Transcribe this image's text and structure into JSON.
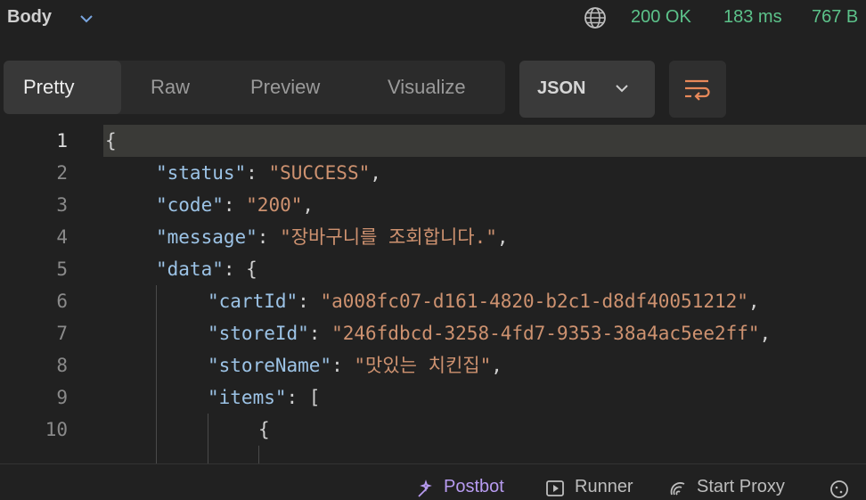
{
  "response": {
    "body_label": "Body",
    "status": "200 OK",
    "time": "183 ms",
    "size": "767 B"
  },
  "view_tabs": [
    {
      "label": "Pretty",
      "active": true
    },
    {
      "label": "Raw",
      "active": false
    },
    {
      "label": "Preview",
      "active": false
    },
    {
      "label": "Visualize",
      "active": false
    }
  ],
  "format": {
    "selected": "JSON"
  },
  "editor": {
    "current_line": 1,
    "lines": [
      {
        "n": "1",
        "tokens": [
          {
            "t": "p",
            "v": "{"
          }
        ]
      },
      {
        "n": "2",
        "tokens": [
          {
            "t": "k",
            "v": "\"status\""
          },
          {
            "t": "p",
            "v": ": "
          },
          {
            "t": "s",
            "v": "\"SUCCESS\""
          },
          {
            "t": "p",
            "v": ","
          }
        ]
      },
      {
        "n": "3",
        "tokens": [
          {
            "t": "k",
            "v": "\"code\""
          },
          {
            "t": "p",
            "v": ": "
          },
          {
            "t": "s",
            "v": "\"200\""
          },
          {
            "t": "p",
            "v": ","
          }
        ]
      },
      {
        "n": "4",
        "tokens": [
          {
            "t": "k",
            "v": "\"message\""
          },
          {
            "t": "p",
            "v": ": "
          },
          {
            "t": "s",
            "v": "\"장바구니를 조회합니다.\""
          },
          {
            "t": "p",
            "v": ","
          }
        ]
      },
      {
        "n": "5",
        "tokens": [
          {
            "t": "k",
            "v": "\"data\""
          },
          {
            "t": "p",
            "v": ": {"
          }
        ]
      },
      {
        "n": "6",
        "tokens": [
          {
            "t": "k",
            "v": "\"cartId\""
          },
          {
            "t": "p",
            "v": ": "
          },
          {
            "t": "s",
            "v": "\"a008fc07-d161-4820-b2c1-d8df40051212\""
          },
          {
            "t": "p",
            "v": ","
          }
        ]
      },
      {
        "n": "7",
        "tokens": [
          {
            "t": "k",
            "v": "\"storeId\""
          },
          {
            "t": "p",
            "v": ": "
          },
          {
            "t": "s",
            "v": "\"246fdbcd-3258-4fd7-9353-38a4ac5ee2ff\""
          },
          {
            "t": "p",
            "v": ","
          }
        ]
      },
      {
        "n": "8",
        "tokens": [
          {
            "t": "k",
            "v": "\"storeName\""
          },
          {
            "t": "p",
            "v": ": "
          },
          {
            "t": "s",
            "v": "\"맛있는 치킨집\""
          },
          {
            "t": "p",
            "v": ","
          }
        ]
      },
      {
        "n": "9",
        "tokens": [
          {
            "t": "k",
            "v": "\"items\""
          },
          {
            "t": "p",
            "v": ": ["
          }
        ]
      },
      {
        "n": "10",
        "tokens": [
          {
            "t": "p",
            "v": "{"
          }
        ]
      }
    ]
  },
  "footer": {
    "postbot": "Postbot",
    "runner": "Runner",
    "start_proxy": "Start Proxy"
  },
  "colors": {
    "background": "#212121",
    "status_green": "#5cc28a",
    "json_key": "#9cc3e6",
    "json_string": "#ce9270",
    "accent_orange": "#e8895a"
  },
  "icons": [
    "chevron-down-icon",
    "globe-icon",
    "wrap-lines-icon",
    "postbot-icon",
    "runner-icon",
    "proxy-icon"
  ]
}
